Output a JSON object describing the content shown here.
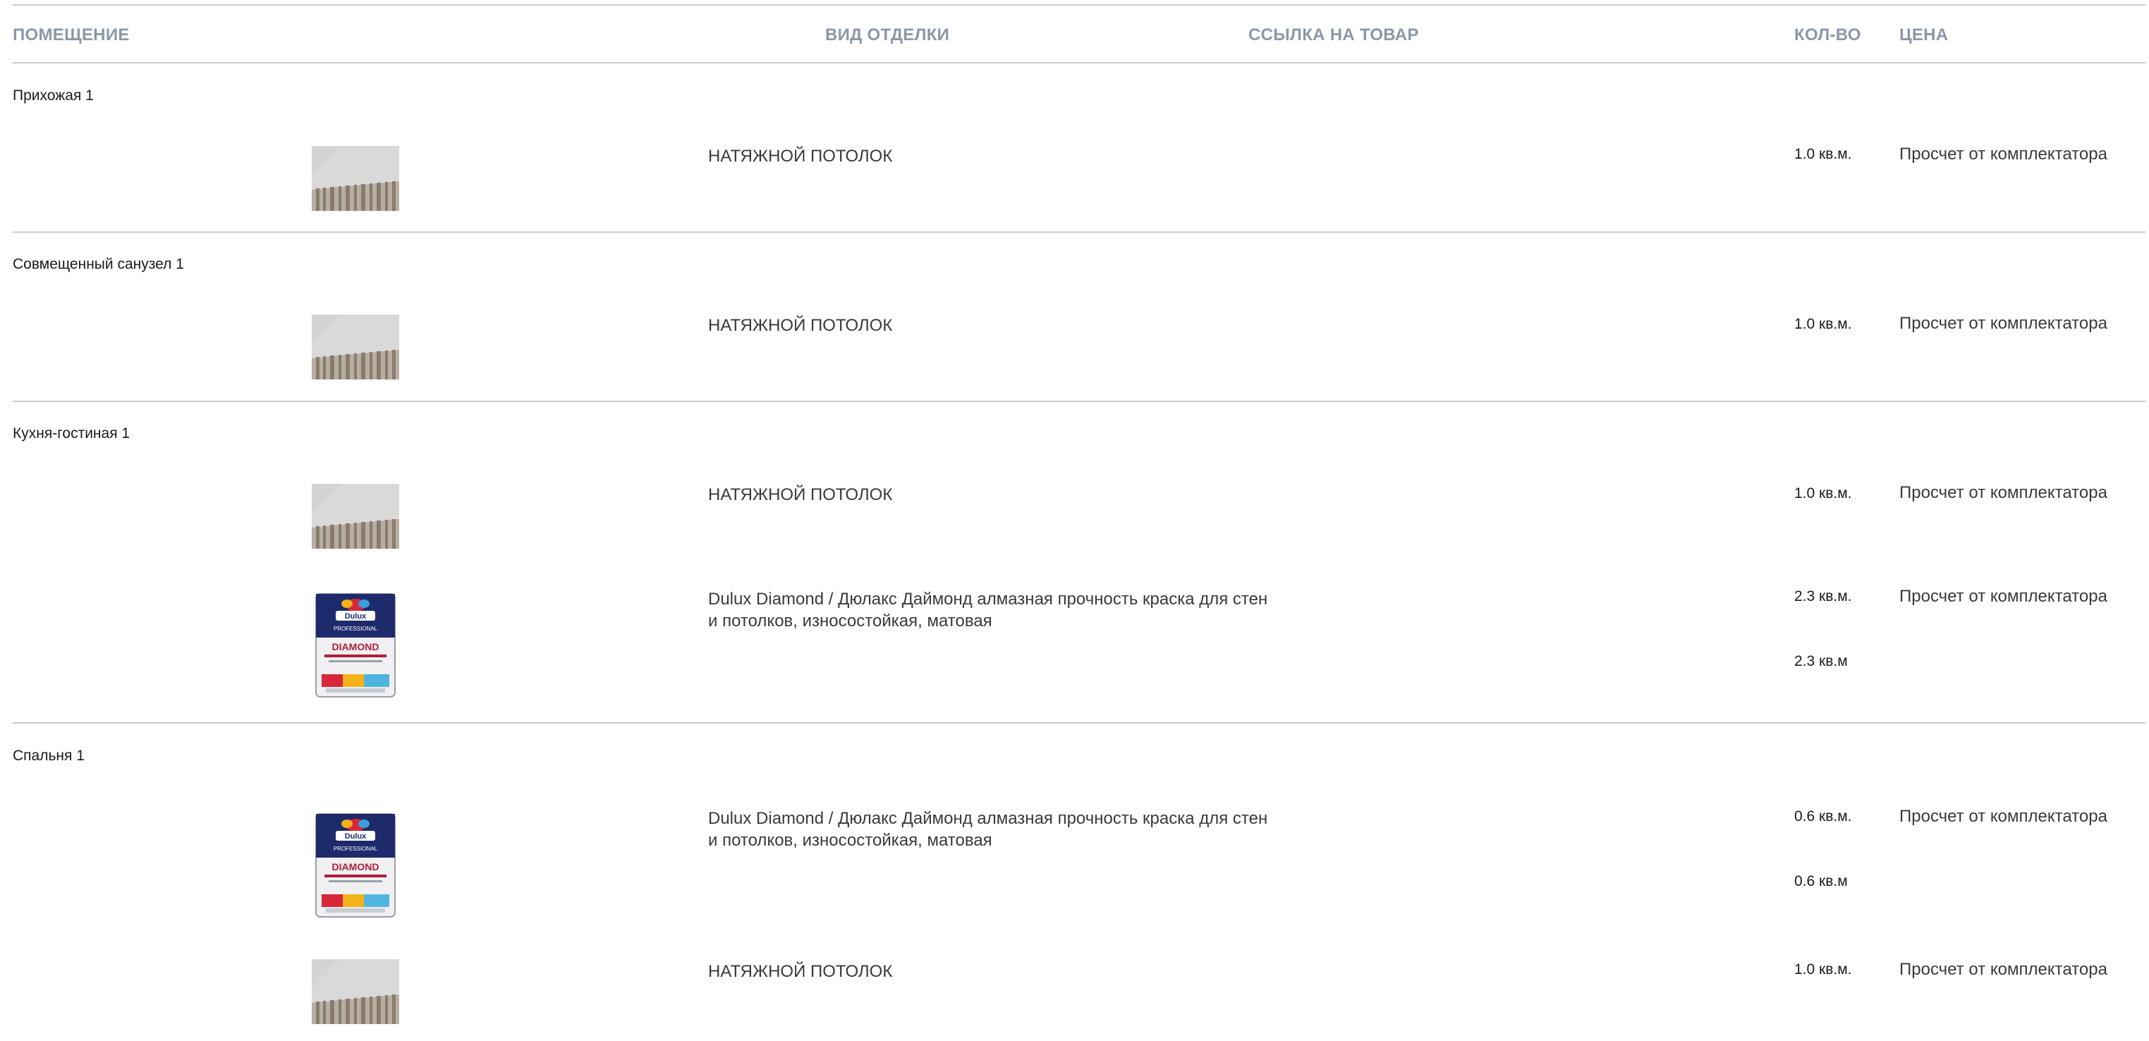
{
  "header": {
    "room": "ПОМЕЩЕНИЕ",
    "finish": "ВИД ОТДЕЛКИ",
    "link": "ССЫЛКА НА ТОВАР",
    "qty": "КОЛ-ВО",
    "price": "ЦЕНА"
  },
  "rooms": [
    {
      "name": "Прихожая 1",
      "items": [
        {
          "image": "ceiling-photo",
          "name": "НАТЯЖНОЙ ПОТОЛОК",
          "qty": "1.0 кв.м.",
          "price": "Просчет от комплектатора"
        }
      ]
    },
    {
      "name": "Совмещенный санузел 1",
      "items": [
        {
          "image": "ceiling-photo",
          "name": "НАТЯЖНОЙ ПОТОЛОК",
          "qty": "1.0 кв.м.",
          "price": "Просчет от комплектатора"
        }
      ]
    },
    {
      "name": "Кухня-гостиная 1",
      "items": [
        {
          "image": "ceiling-photo",
          "name": "НАТЯЖНОЙ ПОТОЛОК",
          "qty": "1.0 кв.м.",
          "price": "Просчет от комплектатора"
        },
        {
          "image": "paint-can-photo",
          "name": "Dulux Diamond / Дюлакс Даймонд алмазная прочность краска для стен и потолков, износостойкая, матовая",
          "qty": "2.3 кв.м.",
          "qty_extra": "2.3 кв.м",
          "price": "Просчет от комплектатора"
        }
      ]
    },
    {
      "name": "Спальня 1",
      "items": [
        {
          "image": "paint-can-photo",
          "name": "Dulux Diamond / Дюлакс Даймонд алмазная прочность краска для стен и потолков, износостойкая, матовая",
          "qty": "0.6 кв.м.",
          "qty_extra": "0.6 кв.м",
          "price": "Просчет от комплектатора"
        },
        {
          "image": "ceiling-photo",
          "name": "НАТЯЖНОЙ ПОТОЛОК",
          "qty": "1.0 кв.м.",
          "price": "Просчет от комплектатора"
        }
      ]
    }
  ],
  "colors": {
    "header_text": "#8c97a8",
    "divider": "#c9ccd3"
  }
}
